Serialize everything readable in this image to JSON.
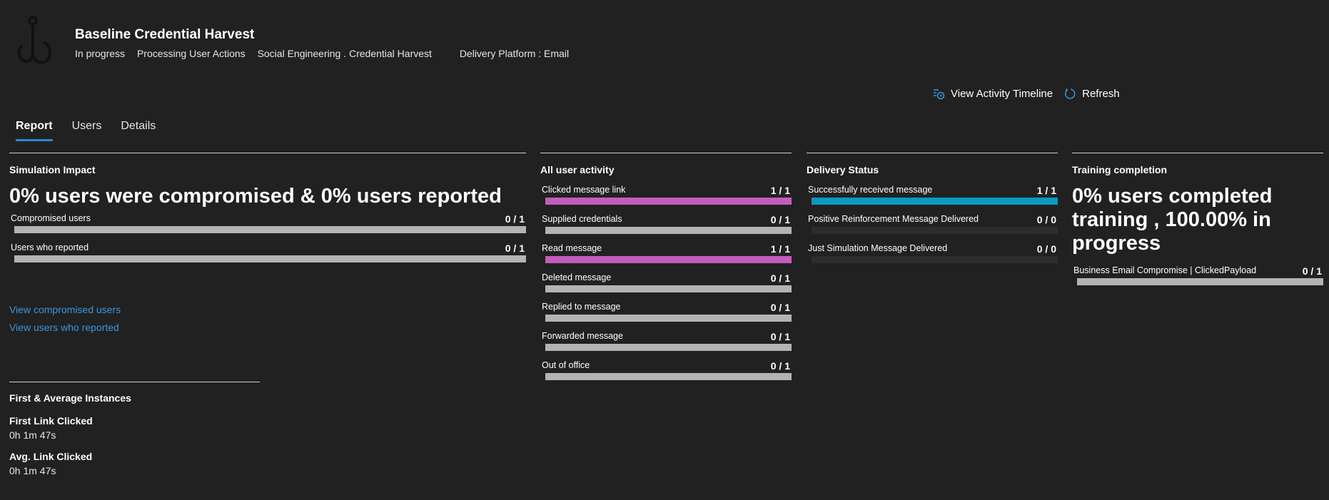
{
  "header": {
    "title": "Baseline Credential Harvest",
    "status": "In progress",
    "stage": "Processing User Actions",
    "technique": "Social Engineering . Credential Harvest",
    "platform": "Delivery Platform : Email"
  },
  "actions": {
    "timeline_label": "View Activity Timeline",
    "refresh_label": "Refresh"
  },
  "tabs": [
    {
      "label": "Report",
      "active": true
    },
    {
      "label": "Users",
      "active": false
    },
    {
      "label": "Details",
      "active": false
    }
  ],
  "simulation_impact": {
    "title": "Simulation Impact",
    "headline": "0% users were compromised & 0% users reported",
    "metrics": [
      {
        "label": "Compromised users",
        "value": "0 / 1",
        "fraction": 0
      },
      {
        "label": "Users who reported",
        "value": "0 / 1",
        "fraction": 0
      }
    ],
    "links": [
      "View compromised users",
      "View users who reported"
    ]
  },
  "instances": {
    "title": "First & Average Instances",
    "first_label": "First Link Clicked",
    "first_value": "0h 1m 47s",
    "avg_label": "Avg. Link Clicked",
    "avg_value": "0h 1m 47s"
  },
  "user_activity": {
    "title": "All user activity",
    "fill_color": "#c55cbc",
    "metrics": [
      {
        "label": "Clicked message link",
        "value": "1 / 1",
        "fraction": 1
      },
      {
        "label": "Supplied credentials",
        "value": "0 / 1",
        "fraction": 0
      },
      {
        "label": "Read message",
        "value": "1 / 1",
        "fraction": 1
      },
      {
        "label": "Deleted message",
        "value": "0 / 1",
        "fraction": 0
      },
      {
        "label": "Replied to message",
        "value": "0 / 1",
        "fraction": 0
      },
      {
        "label": "Forwarded message",
        "value": "0 / 1",
        "fraction": 0
      },
      {
        "label": "Out of office",
        "value": "0 / 1",
        "fraction": 0
      }
    ]
  },
  "delivery_status": {
    "title": "Delivery Status",
    "fill_color": "#0c9ac0",
    "metrics": [
      {
        "label": "Successfully received message",
        "value": "1 / 1",
        "fraction": 1
      },
      {
        "label": "Positive Reinforcement Message Delivered",
        "value": "0 / 0",
        "fraction": 0
      },
      {
        "label": "Just Simulation Message Delivered",
        "value": "0 / 0",
        "fraction": 0
      }
    ]
  },
  "training": {
    "title": "Training completion",
    "headline": "0% users completed training , 100.00% in progress",
    "metrics": [
      {
        "label": "Business Email Compromise | ClickedPayload",
        "value": "0 / 1",
        "fraction": 0
      }
    ]
  }
}
